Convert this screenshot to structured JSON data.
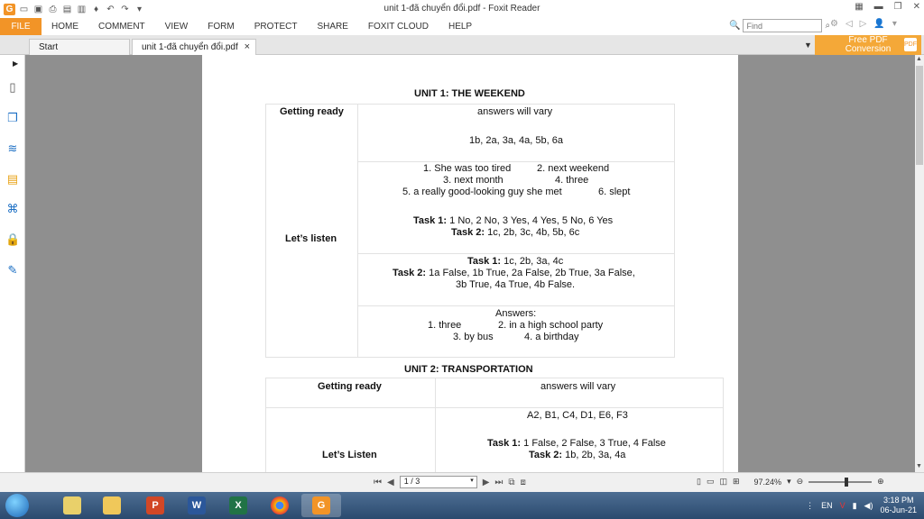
{
  "window": {
    "title": "unit 1-đã chuyển đổi.pdf - Foxit Reader",
    "minimize_icon": "minimize-icon",
    "restore_icon": "restore-icon",
    "close_icon": "close-icon"
  },
  "ribbon": {
    "file": "FILE",
    "tabs": [
      "HOME",
      "COMMENT",
      "VIEW",
      "FORM",
      "PROTECT",
      "SHARE",
      "FOXIT CLOUD",
      "HELP"
    ],
    "find_placeholder": "Find"
  },
  "tabs": {
    "start": "Start",
    "document": "unit 1-đã chuyển đổi.pdf",
    "close": "×"
  },
  "promo": {
    "line1": "Free PDF",
    "line2": "Conversion",
    "badge": "PDF"
  },
  "doc": {
    "unit1_title": "UNIT 1: THE WEEKEND",
    "unit1": {
      "getting_ready_label": "Getting ready",
      "getting_ready_a": "answers will vary",
      "getting_ready_b": "1b, 2a, 3a, 4a, 5b, 6a",
      "lets_listen_label": "Let’s listen",
      "list1_row1a": "1. She was too tired",
      "list1_row1b": "2. next weekend",
      "list1_row2a": "3. next month",
      "list1_row2b": "4. three",
      "list1_row3a": "5. a really good-looking guy she met",
      "list1_row3b": "6. slept",
      "taskA1_label": "Task 1:",
      "taskA1_value": " 1 No, 2 No, 3 Yes, 4 Yes, 5 No, 6 Yes",
      "taskA2_label": "Task 2:",
      "taskA2_value": " 1c, 2b, 3c, 4b, 5b, 6c",
      "taskB1_label": "Task 1:",
      "taskB1_value": " 1c, 2b, 3a, 4c",
      "taskB2_label": "Task 2:",
      "taskB2_value": " 1a False, 1b True, 2a False, 2b True, 3a False,",
      "taskB2_value2": "3b True, 4a True, 4b False.",
      "answers_label": "Answers:",
      "ans_1": "1. three",
      "ans_2": "2. in a high school party",
      "ans_3": "3. by bus",
      "ans_4": "4. a birthday"
    },
    "unit2_title": "UNIT 2: TRANSPORTATION",
    "unit2": {
      "getting_ready_label": "Getting ready",
      "getting_ready_a": "answers will vary",
      "lets_listen_label": "Let’s Listen",
      "codes": "A2, B1, C4, D1, E6, F3",
      "task1_label": "Task 1:",
      "task1_value": " 1 False, 2 False, 3 True, 4 False",
      "task2_label": "Task 2:",
      "task2_value": " 1b, 2b, 3a, 4a"
    }
  },
  "status": {
    "page_value": "1 / 3",
    "zoom": "97.24%"
  },
  "taskbar": {
    "lang": "EN",
    "time": "3:18 PM",
    "date": "06-Jun-21",
    "apps": [
      "folder-app",
      "explorer-app",
      "powerpoint-app",
      "word-app",
      "excel-app",
      "chrome-app",
      "foxit-app"
    ]
  },
  "colors": {
    "accent": "#f29427",
    "doc_bg": "#8f8f8f"
  }
}
